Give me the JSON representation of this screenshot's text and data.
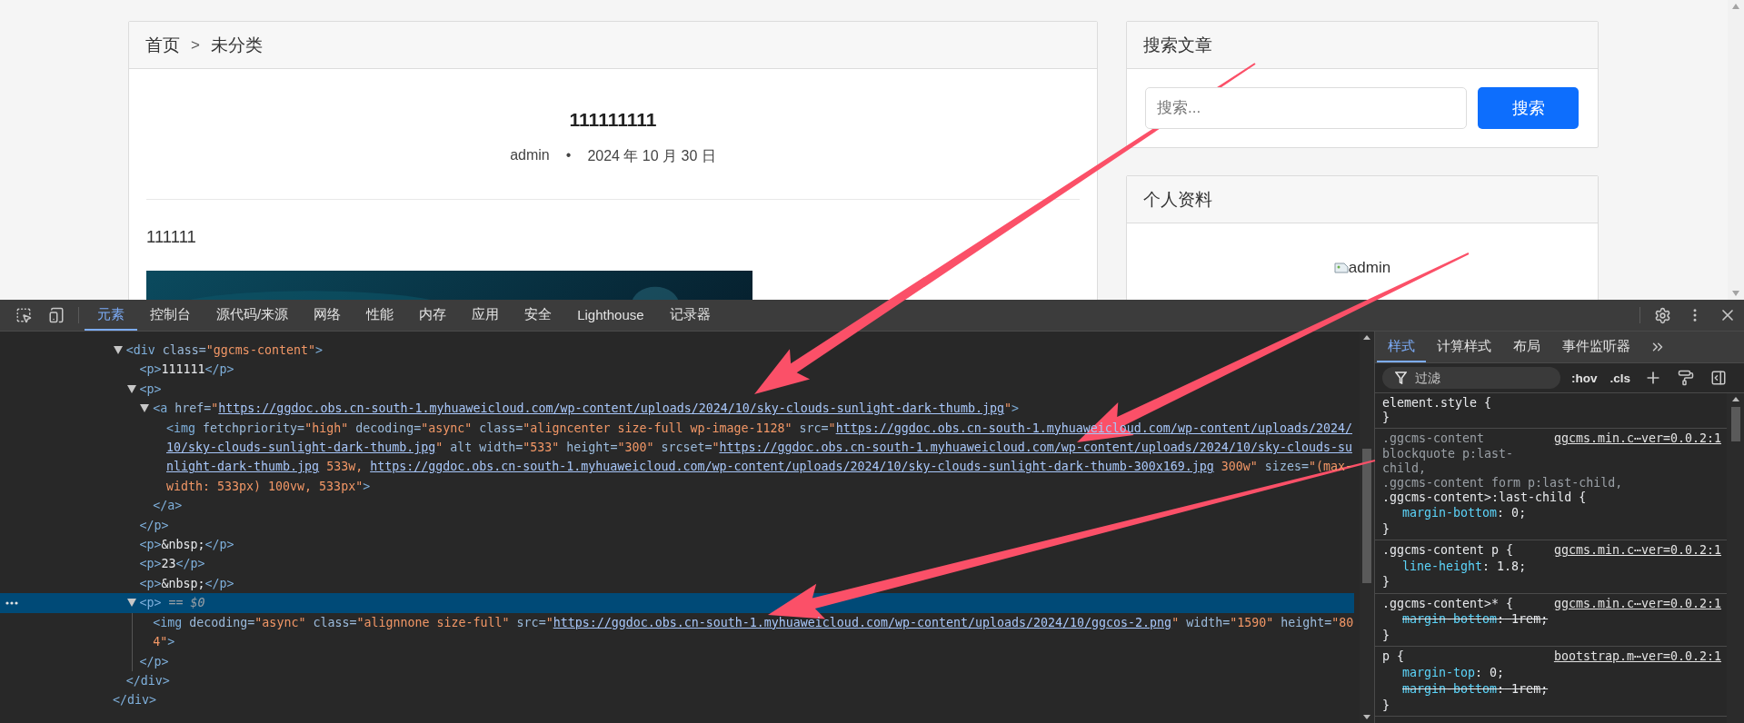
{
  "page": {
    "breadcrumb": [
      {
        "label": "首页"
      },
      {
        "label": "未分类"
      }
    ],
    "breadcrumb_separator": ">",
    "post": {
      "title": "111111111",
      "author": "admin",
      "meta_separator": "•",
      "date": "2024 年 10 月 30 日",
      "paragraph": "111111"
    },
    "sidebar": [
      {
        "kind": "search",
        "title": "搜索文章",
        "placeholder": "搜索...",
        "button": "搜索"
      },
      {
        "kind": "profile",
        "title": "个人资料",
        "avatar_alt": "admin"
      }
    ]
  },
  "devtools": {
    "tabs": [
      {
        "label": "元素",
        "selected": true
      },
      {
        "label": "控制台",
        "selected": false
      },
      {
        "label": "源代码/来源",
        "selected": false
      },
      {
        "label": "网络",
        "selected": false
      },
      {
        "label": "性能",
        "selected": false
      },
      {
        "label": "内存",
        "selected": false
      },
      {
        "label": "应用",
        "selected": false
      },
      {
        "label": "安全",
        "selected": false
      },
      {
        "label": "Lighthouse",
        "selected": false
      },
      {
        "label": "记录器",
        "selected": false
      }
    ],
    "elements": {
      "nodes": [
        {
          "open": "<div class=\"ggcms-content\">",
          "expanded": true,
          "selected": false,
          "children": [
            {
              "open": "<p>111111</p>",
              "selected": false
            },
            {
              "open": "<p>",
              "expanded": true,
              "selected": false,
              "children": [
                {
                  "open": "<a href=\"https://ggdoc.obs.cn-south-1.myhuaweicloud.com/wp-content/uploads/2024/10/sky-clouds-sunlight-dark-thumb.jpg\">",
                  "expanded": true,
                  "selected": false,
                  "children": [
                    {
                      "open": "<img fetchpriority=\"high\" decoding=\"async\" class=\"aligncenter size-full wp-image-1128\" src=\"https://ggdoc.obs.cn-south-1.myhuaweicloud.com/wp-content/uploads/2024/10/sky-clouds-sunlight-dark-thumb.jpg\" alt width=\"533\" height=\"300\" srcset=\"https://ggdoc.obs.cn-south-1.myhuaweicloud.com/wp-content/uploads/2024/10/sky-clouds-sunlight-dark-thumb.jpg 533w, https://ggdoc.obs.cn-south-1.myhuaweicloud.com/wp-content/uploads/2024/10/sky-clouds-sunlight-dark-thumb-300x169.jpg 300w\" sizes=\"(max-width: 533px) 100vw, 533px\">",
                      "selected": false
                    }
                  ],
                  "close": "</a>"
                }
              ],
              "close": "</p>"
            },
            {
              "open": "<p>&nbsp;</p>",
              "selected": false
            },
            {
              "open": "<p>23</p>",
              "selected": false
            },
            {
              "open": "<p>&nbsp;</p>",
              "selected": false
            },
            {
              "open": "<p>",
              "suffix": "== $0",
              "expanded": true,
              "selected": true,
              "children": [
                {
                  "open": "<img decoding=\"async\" class=\"alignnone size-full\" src=\"https://ggdoc.obs.cn-south-1.myhuaweicloud.com/wp-content/uploads/2024/10/ggcos-2.png\" width=\"1590\" height=\"804\">",
                  "selected": false
                }
              ],
              "close": "</p>"
            }
          ],
          "close": "</div>"
        }
      ],
      "parent_close": "</div>"
    },
    "styles": {
      "tabs": [
        {
          "label": "样式",
          "selected": true
        },
        {
          "label": "计算样式",
          "selected": false
        },
        {
          "label": "布局",
          "selected": false
        },
        {
          "label": "事件监听器",
          "selected": false
        }
      ],
      "filter_placeholder": "过滤",
      "toggles": [
        ":hov",
        ".cls"
      ],
      "syntax": {
        "open_brace": "{",
        "close_brace": "}",
        "colon": ":",
        "semicolon": ";"
      },
      "rules": [
        {
          "selectors": [
            {
              "text": "element.style",
              "matched": true
            }
          ]
        },
        {
          "selectors": [
            {
              "text": ".ggcms-content blockquote p:last-child,",
              "matched": false
            },
            {
              "text": ".ggcms-content form p:last-child,",
              "matched": false
            },
            {
              "text": ".ggcms-content>:last-child",
              "matched": true
            }
          ],
          "source": "ggcms.min.c⋯ver=0.0.2:1",
          "props": [
            {
              "name": "margin-bottom",
              "value": "0",
              "struck": false
            }
          ]
        },
        {
          "selectors": [
            {
              "text": ".ggcms-content p",
              "matched": true
            }
          ],
          "source": "ggcms.min.c⋯ver=0.0.2:1",
          "props": [
            {
              "name": "line-height",
              "value": "1.8",
              "struck": false
            }
          ]
        },
        {
          "selectors": [
            {
              "text": ".ggcms-content>*",
              "matched": true
            }
          ],
          "source": "ggcms.min.c⋯ver=0.0.2:1",
          "props": [
            {
              "name": "margin-bottom",
              "value": "1rem",
              "struck": true
            }
          ]
        },
        {
          "selectors": [
            {
              "text": "p",
              "matched": true
            }
          ],
          "source": "bootstrap.m⋯ver=0.0.2:1",
          "props": [
            {
              "name": "margin-top",
              "value": "0",
              "struck": false
            },
            {
              "name": "margin-bottom",
              "value": "1rem",
              "struck": true
            }
          ]
        }
      ]
    }
  }
}
